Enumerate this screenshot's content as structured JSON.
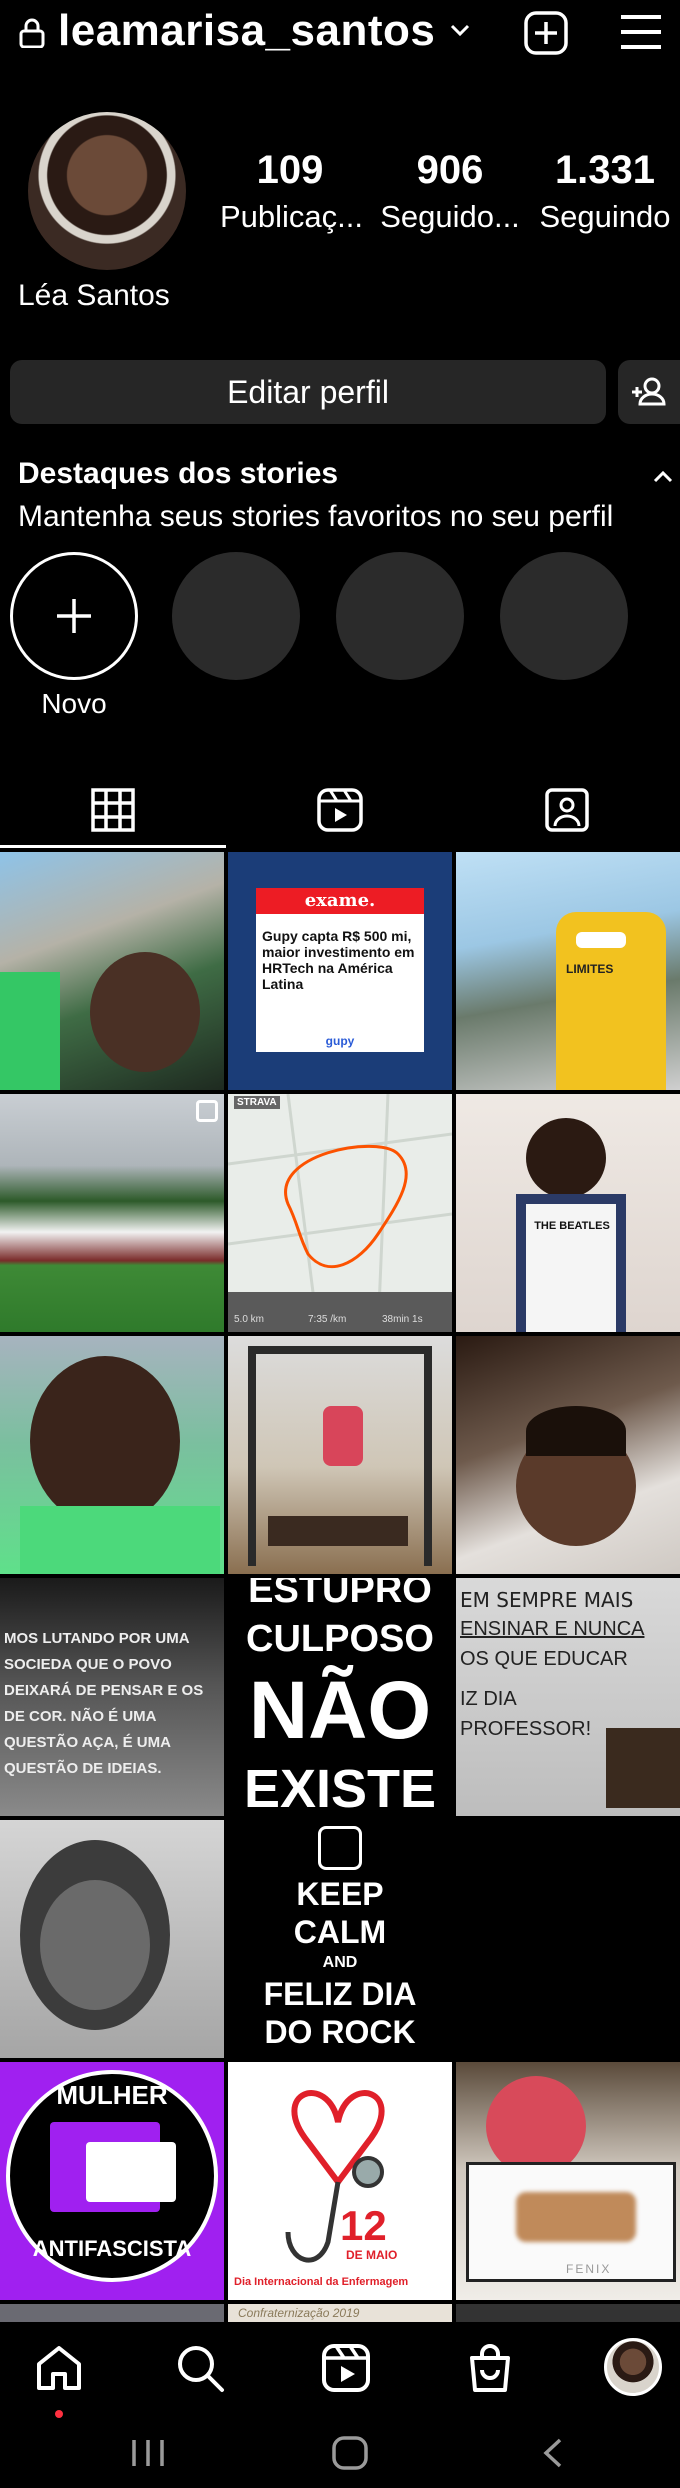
{
  "header": {
    "username": "leamarisa_santos",
    "icons": [
      "lock-icon",
      "chevron-down-icon",
      "add-square-icon",
      "menu-icon"
    ]
  },
  "profile": {
    "display_name": "Léa Santos",
    "stats": [
      {
        "value": "109",
        "label": "Publicaç..."
      },
      {
        "value": "906",
        "label": "Seguido..."
      },
      {
        "value": "1.331",
        "label": "Seguindo"
      }
    ],
    "edit_button": "Editar perfil"
  },
  "highlights": {
    "title": "Destaques dos stories",
    "subtitle": "Mantenha seus stories favoritos no seu perfil",
    "new_label": "Novo"
  },
  "tabs": [
    "grid-icon",
    "reels-icon",
    "tagged-icon"
  ],
  "posts": {
    "exame_brand": "exame.",
    "exame_headline": "Gupy capta R$ 500 mi, maior investimento em HRTech na América Latina",
    "exame_footer": "gupy",
    "strava_brand": "STRAVA",
    "strava_stats": [
      "5.0 km",
      "7:35 /km",
      "38min 1s"
    ],
    "tshirt_text": "THE BEATLES",
    "quote1": "MOS LUTANDO POR UMA SOCIEDA QUE O POVO DEIXARÁ DE PENSAR E OS DE COR. NÃO É UMA QUESTÃO AÇA, É UMA QUESTÃO DE IDEIAS.",
    "estupro": [
      "ESTUPRO",
      "CULPOSO",
      "NÃO",
      "EXISTE"
    ],
    "teacher": [
      "EM SEMPRE MAIS",
      "ENSINAR E NUNCA",
      "OS QUE EDUCAR",
      "IZ DIA",
      "PROFESSOR!"
    ],
    "keepcalm": [
      "KEEP",
      "CALM",
      "AND",
      "FELIZ DIA",
      "DO ROCK"
    ],
    "mulher": [
      "MULHER",
      "ANTIFASCISTA"
    ],
    "nursing": [
      "12",
      "DE MAIO",
      "Dia Internacional da Enfermagem"
    ],
    "fenix": "FENIX",
    "partial": "Confraternização 2019"
  },
  "nav": [
    "home-icon",
    "search-icon",
    "reels-icon",
    "shop-icon",
    "profile-avatar"
  ],
  "colors": {
    "background": "#000000",
    "button": "#262626",
    "accent_red": "#ed1c24",
    "purple": "#a020f0",
    "notify": "#ff3040"
  }
}
